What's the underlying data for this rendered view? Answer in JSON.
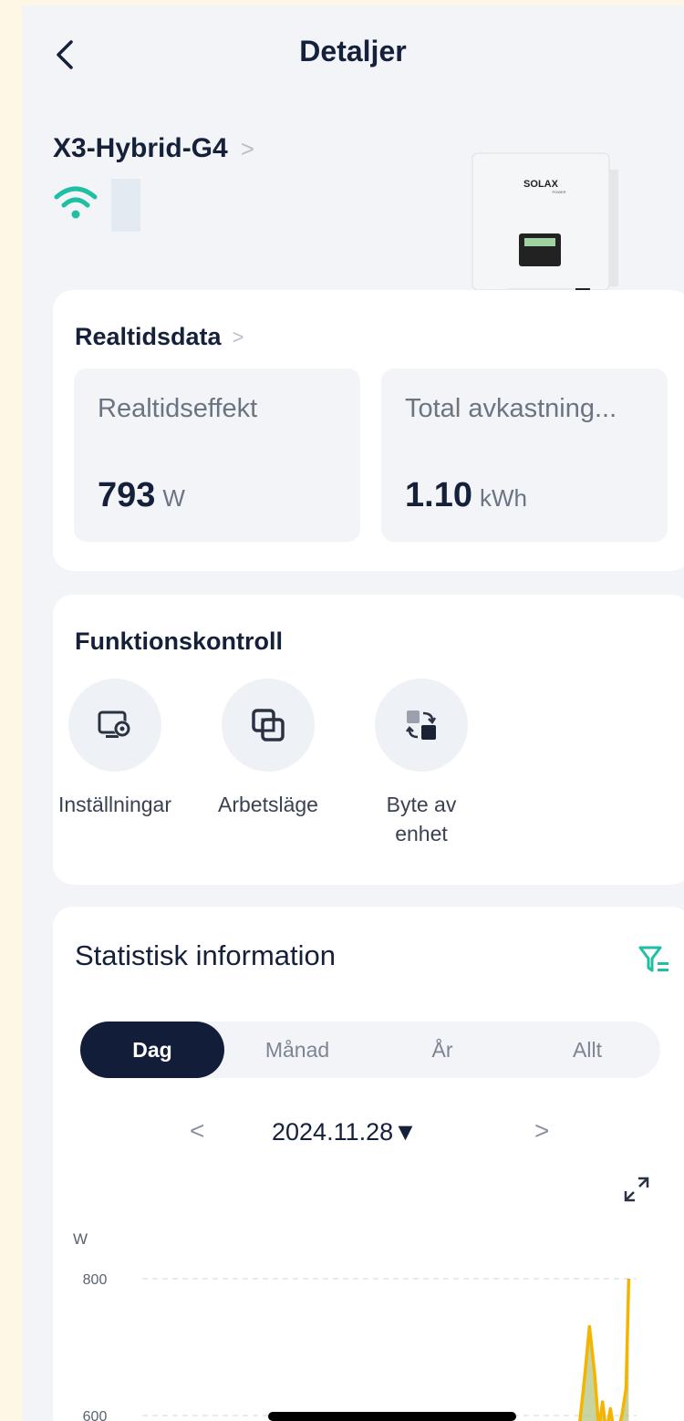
{
  "header": {
    "title": "Detaljer",
    "back_icon": "chevron-left-icon"
  },
  "device": {
    "name": "X3-Hybrid-G4",
    "chevron": ">",
    "wifi_icon": "wifi-icon",
    "brand": "SOLAX",
    "brand_sub": "POWER"
  },
  "realtime": {
    "title": "Realtidsdata",
    "chevron": ">",
    "power": {
      "label": "Realtidseffekt",
      "value": "793",
      "unit": "W"
    },
    "yield": {
      "label": "Total avkastning...",
      "value": "1.10",
      "unit": "kWh"
    }
  },
  "functions": {
    "title": "Funktionskontroll",
    "items": [
      {
        "label": "Inställningar",
        "icon": "settings-monitor-icon"
      },
      {
        "label": "Arbetsläge",
        "icon": "work-mode-icon"
      },
      {
        "label": "Byte av enhet",
        "icon": "switch-device-icon"
      }
    ]
  },
  "statistics": {
    "title": "Statistisk information",
    "filter_icon": "filter-icon",
    "tabs": [
      "Dag",
      "Månad",
      "År",
      "Allt"
    ],
    "active_tab": "Dag",
    "date": "2024.11.28",
    "date_caret": "▼",
    "prev": "<",
    "next": ">",
    "expand_icon": "expand-icon"
  },
  "chart_data": {
    "type": "area",
    "ylabel": "W",
    "yticks": [
      600,
      800
    ],
    "ylim": [
      560,
      820
    ],
    "xlim": [
      0,
      100
    ],
    "line_color": "#f4b400",
    "fill_color": "#b9c98a",
    "x": [
      88,
      89,
      90,
      91,
      92,
      92.8,
      93.5,
      94.2,
      95,
      95.8,
      96.5,
      97.2,
      98,
      98.5
    ],
    "values": [
      560,
      580,
      650,
      730,
      660,
      580,
      620,
      575,
      610,
      570,
      580,
      600,
      640,
      800
    ]
  }
}
